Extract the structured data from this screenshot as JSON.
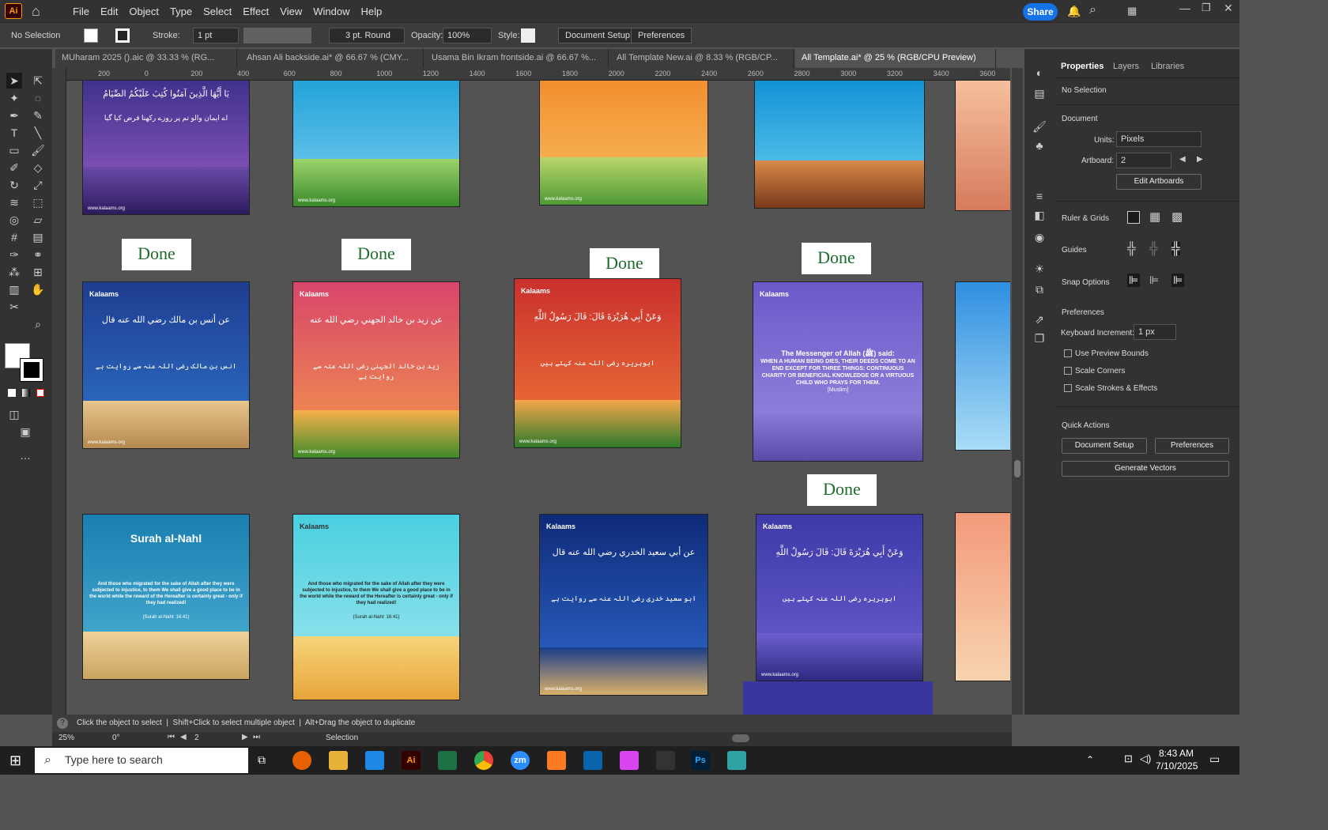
{
  "menubar": {
    "logo": "Ai",
    "items": [
      "File",
      "Edit",
      "Object",
      "Type",
      "Select",
      "Effect",
      "View",
      "Window",
      "Help"
    ],
    "share_label": "Share"
  },
  "control_bar": {
    "selection": "No Selection",
    "stroke_label": "Stroke:",
    "stroke_value": "1 pt",
    "brush": "3 pt. Round",
    "opacity_label": "Opacity:",
    "opacity_value": "100%",
    "style_label": "Style:",
    "document_setup": "Document Setup",
    "preferences": "Preferences"
  },
  "tabs": [
    "MUharam 2025 ().aic @ 33.33 % (RG...",
    "Ahsan Ali backside.ai* @ 66.67 % (CMY...",
    "Usama Bin Ikram frontside.ai @ 66.67 %...",
    "All Template New.ai @ 8.33 % (RGB/CP...",
    "All Template.ai* @ 25 % (RGB/CPU Preview)"
  ],
  "ruler_top": [
    "200",
    "0",
    "200",
    "400",
    "600",
    "800",
    "1000",
    "1200",
    "1400",
    "1600",
    "1800",
    "2000",
    "2200",
    "2400",
    "2600",
    "2800",
    "3000",
    "3200",
    "3400",
    "3600"
  ],
  "canvas": {
    "done_label": "Done",
    "brand": "Kalaams",
    "site": "www.kalaams.org",
    "surah_title": "Surah al-Nahl",
    "english_text": "And those who migrated for the sake of Allah after they were subjected to injustice, to them We shall give a good place to be in the world while the reward of the Hereafter is certainly great - only if they had realized!",
    "surah_ref": "(Surah al-Nahl: 16:41)",
    "messenger_text": "The Messenger of Allah (ﷺ) said:",
    "hadith_english": "WHEN A HUMAN BEING DIES, THEIR DEEDS COME TO AN END EXCEPT FOR THREE THINGS: CONTINUOUS CHARITY OR BENEFICIAL KNOWLEDGE OR A VIRTUOUS CHILD WHO PRAYS FOR THEM.",
    "muslim_ref": "[Muslim]",
    "arabic_1": "يَا أَيُّهَا الَّذِينَ آمَنُوا كُتِبَ عَلَيْكُمُ الصِّيَامُ",
    "urdu_1": "اے ایمان والو تم پر روزے رکھنا فرض کیا گیا",
    "arabic_2": "عن أنس بن مالك رضي الله عنه قال",
    "urdu_2": "انس بن مالک رضی اللہ عنہ سے روایت ہے",
    "arabic_3": "عن زيد بن خالد الجهني رضي الله عنه",
    "urdu_3": "زید بن خالد الجہنی رضی اللہ عنہ سے روایت ہے",
    "arabic_4": "وَعَنْ أَبِي هُرَيْرَةَ قَالَ: قَالَ رَسُولُ اللَّهِ",
    "urdu_4": "ابوہریرہ رضی اللہ عنہ کہتے ہیں",
    "arabic_5": "عن أبي سعيد الخدري رضي الله عنه قال",
    "urdu_5": "ابو سعید خدری رضی اللہ عنہ سے روایت ہے"
  },
  "properties_panel": {
    "tabs": [
      "Properties",
      "Layers",
      "Libraries"
    ],
    "no_selection": "No Selection",
    "document": "Document",
    "units_label": "Units:",
    "units_value": "Pixels",
    "artboard_label": "Artboard:",
    "artboard_value": "2",
    "edit_artboards": "Edit Artboards",
    "ruler_grids": "Ruler & Grids",
    "guides": "Guides",
    "snap_options": "Snap Options",
    "preferences": "Preferences",
    "keyboard_increment_label": "Keyboard Increment:",
    "keyboard_increment_value": "1 px",
    "use_preview_bounds": "Use Preview Bounds",
    "scale_corners": "Scale Corners",
    "scale_strokes": "Scale Strokes & Effects",
    "quick_actions": "Quick Actions",
    "document_setup": "Document Setup",
    "preferences_btn": "Preferences",
    "generate_vectors": "Generate Vectors"
  },
  "status": {
    "hint": "Click the object to select  |  Shift+Click to select multiple object  |  Alt+Drag the object to duplicate",
    "zoom": "25%",
    "rotation": "0°",
    "artboard": "2",
    "mode": "Selection"
  },
  "taskbar": {
    "search_placeholder": "Type here to search",
    "time": "8:43 AM",
    "date": "7/10/2025",
    "apps": [
      "Ai",
      "Ps",
      "zm"
    ]
  }
}
